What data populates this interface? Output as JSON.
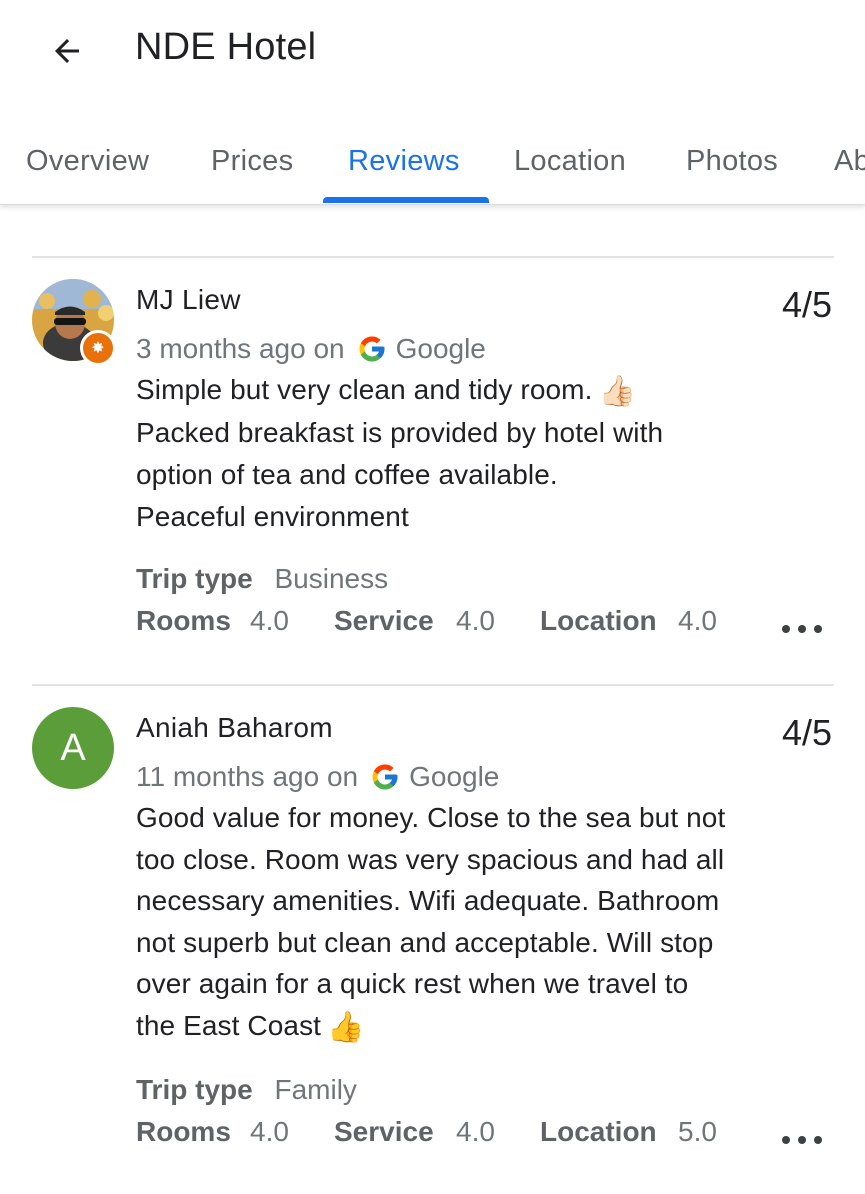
{
  "header": {
    "title": "NDE Hotel"
  },
  "tabs": [
    {
      "label": "Overview"
    },
    {
      "label": "Prices"
    },
    {
      "label": "Reviews"
    },
    {
      "label": "Location"
    },
    {
      "label": "Photos"
    },
    {
      "label": "Ab"
    }
  ],
  "active_tab": "Reviews",
  "colors": {
    "accent": "#1a73e8",
    "avatar_green": "#5b9e39",
    "guide_badge": "#e8710a"
  },
  "reviews": [
    {
      "name": "MJ Liew",
      "score": "4/5",
      "time_prefix": "3 months ago on",
      "source": "Google",
      "avatar": {
        "type": "photo",
        "badge": "local-guide-icon"
      },
      "lines": [
        "Simple but very clean and tidy room.",
        "Packed breakfast is provided by hotel with",
        "option of tea and coffee available.",
        "Peaceful environment"
      ],
      "emoji": "👍🏻",
      "trip_label": "Trip type",
      "trip_value": "Business",
      "ratings": {
        "rooms_label": "Rooms",
        "rooms": "4.0",
        "service_label": "Service",
        "service": "4.0",
        "location_label": "Location",
        "location": "4.0"
      }
    },
    {
      "name": "Aniah Baharom",
      "score": "4/5",
      "time_prefix": "11 months ago on",
      "source": "Google",
      "avatar": {
        "type": "letter",
        "letter": "A"
      },
      "lines": [
        "Good value for money. Close to the sea but not",
        "too close. Room was very spacious and had all",
        "necessary amenities. Wifi adequate. Bathroom",
        "not superb but clean and acceptable. Will stop",
        "over again for a quick rest when we travel to",
        "the East Coast"
      ],
      "emoji": "👍",
      "trip_label": "Trip type",
      "trip_value": "Family",
      "ratings": {
        "rooms_label": "Rooms",
        "rooms": "4.0",
        "service_label": "Service",
        "service": "4.0",
        "location_label": "Location",
        "location": "5.0"
      }
    }
  ]
}
